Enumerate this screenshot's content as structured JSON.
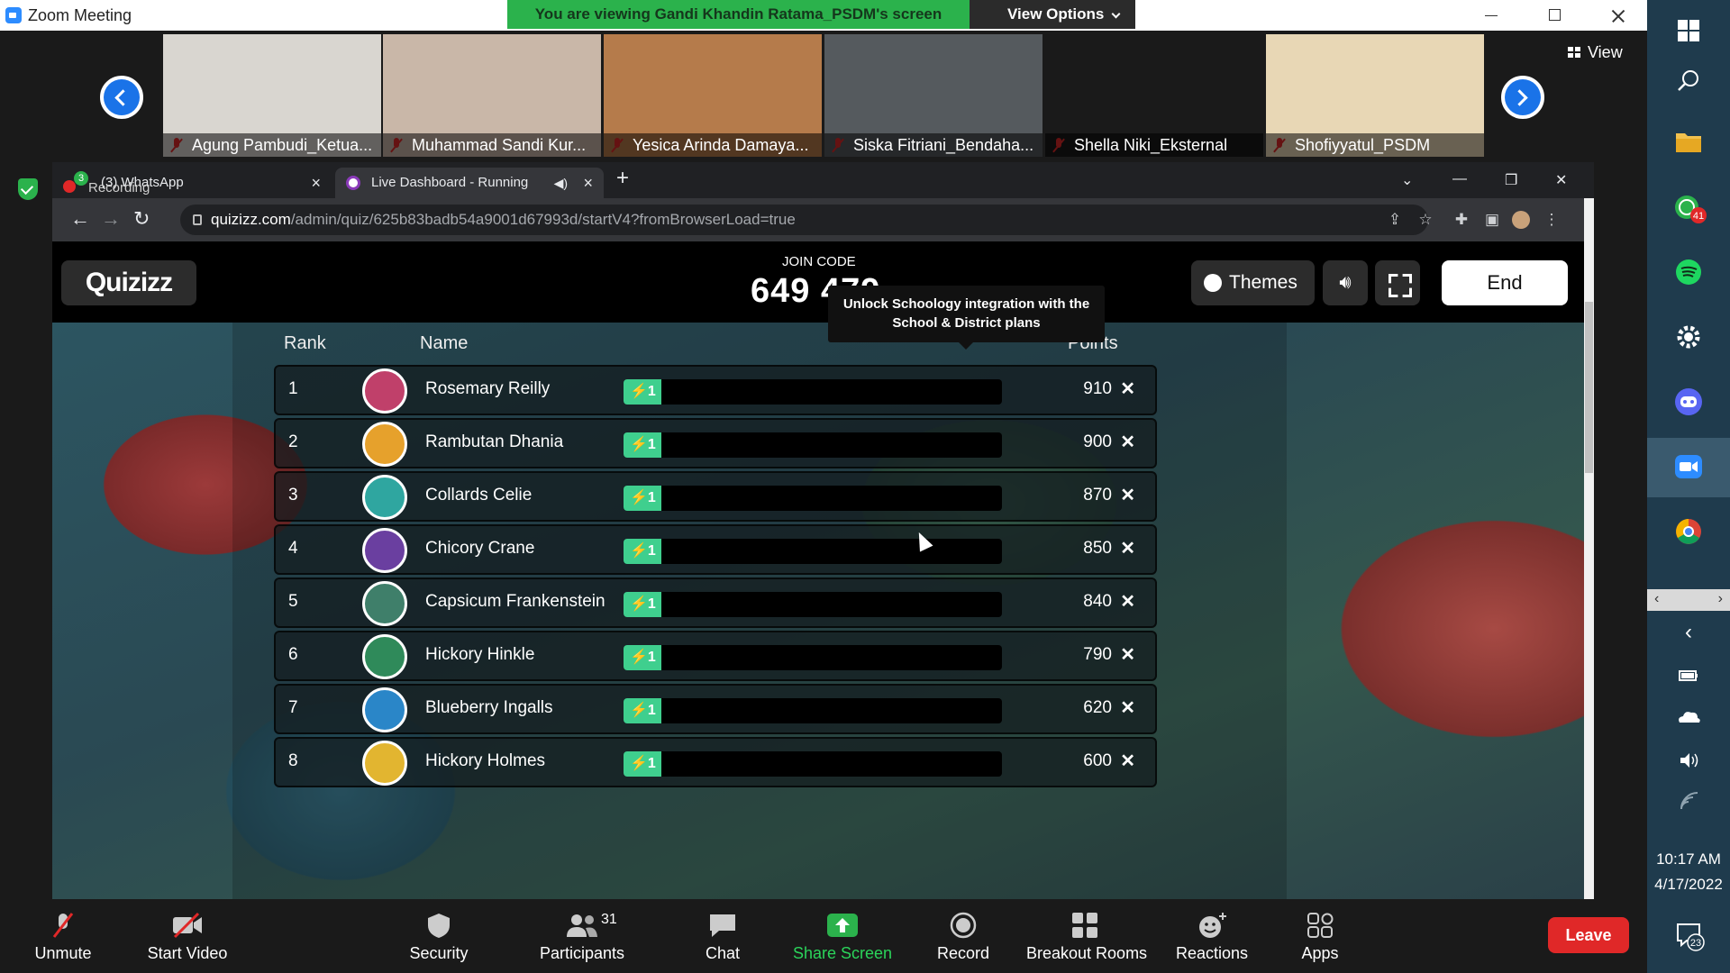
{
  "window": {
    "title": "Zoom Meeting",
    "banner": "You are viewing Gandi Khandin Ratama_PSDM's screen",
    "view_options": "View Options"
  },
  "strip": {
    "view_label": "View",
    "participants": [
      {
        "name": "Agung Pambudi_Ketua...",
        "bg": "#d9d6d0"
      },
      {
        "name": "Muhammad Sandi Kur...",
        "bg": "#c9b7a8"
      },
      {
        "name": "Yesica Arinda Damaya...",
        "bg": "#b57b4b"
      },
      {
        "name": "Siska Fitriani_Bendaha...",
        "bg": "#555a5e"
      },
      {
        "name": "Shella Niki_Eksternal",
        "bg": "#1a1a1a"
      },
      {
        "name": "Shofiyyatul_PSDM",
        "bg": "#e8d7b5"
      }
    ]
  },
  "recording": {
    "label": "Recording",
    "badge": "3"
  },
  "browser": {
    "tabs": [
      {
        "title": "(3) WhatsApp"
      },
      {
        "title": "Live Dashboard - Running"
      }
    ],
    "url_domain": "quizizz.com",
    "url_rest": "/admin/quiz/625b83badb54a9001d67993d/startV4?fromBrowserLoad=true"
  },
  "quizizz": {
    "logo": "Quizizz",
    "join_label": "JOIN CODE",
    "join_code": "649 479",
    "tooltip_line1": "Unlock Schoology integration with the",
    "tooltip_line2": "School & District plans",
    "themes_label": "Themes",
    "end_label": "End",
    "headers": {
      "rank": "Rank",
      "name": "Name",
      "points": "Points"
    },
    "rows": [
      {
        "rank": "1",
        "name": "Rosemary Reilly",
        "streak": "1",
        "points": "910",
        "avatar_color": "#c0406a"
      },
      {
        "rank": "2",
        "name": "Rambutan Dhania",
        "streak": "1",
        "points": "900",
        "avatar_color": "#e6a12c"
      },
      {
        "rank": "3",
        "name": "Collards Celie",
        "streak": "1",
        "points": "870",
        "avatar_color": "#2fa6a0"
      },
      {
        "rank": "4",
        "name": "Chicory Crane",
        "streak": "1",
        "points": "850",
        "avatar_color": "#6a3fa0"
      },
      {
        "rank": "5",
        "name": "Capsicum Frankenstein",
        "streak": "1",
        "points": "840",
        "avatar_color": "#3f7f6a"
      },
      {
        "rank": "6",
        "name": "Hickory Hinkle",
        "streak": "1",
        "points": "790",
        "avatar_color": "#2f8a5a"
      },
      {
        "rank": "7",
        "name": "Blueberry Ingalls",
        "streak": "1",
        "points": "620",
        "avatar_color": "#2a86c8"
      },
      {
        "rank": "8",
        "name": "Hickory Holmes",
        "streak": "1",
        "points": "600",
        "avatar_color": "#e2b530"
      }
    ]
  },
  "toolbar": {
    "unmute": "Unmute",
    "start_video": "Start Video",
    "security": "Security",
    "participants": "Participants",
    "participants_count": "31",
    "chat": "Chat",
    "share_screen": "Share Screen",
    "record": "Record",
    "breakout": "Breakout Rooms",
    "reactions": "Reactions",
    "apps": "Apps",
    "leave": "Leave"
  },
  "taskbar": {
    "whatsapp_badge": "41",
    "time": "10:17 AM",
    "date": "4/17/2022",
    "notif_count": "23"
  }
}
